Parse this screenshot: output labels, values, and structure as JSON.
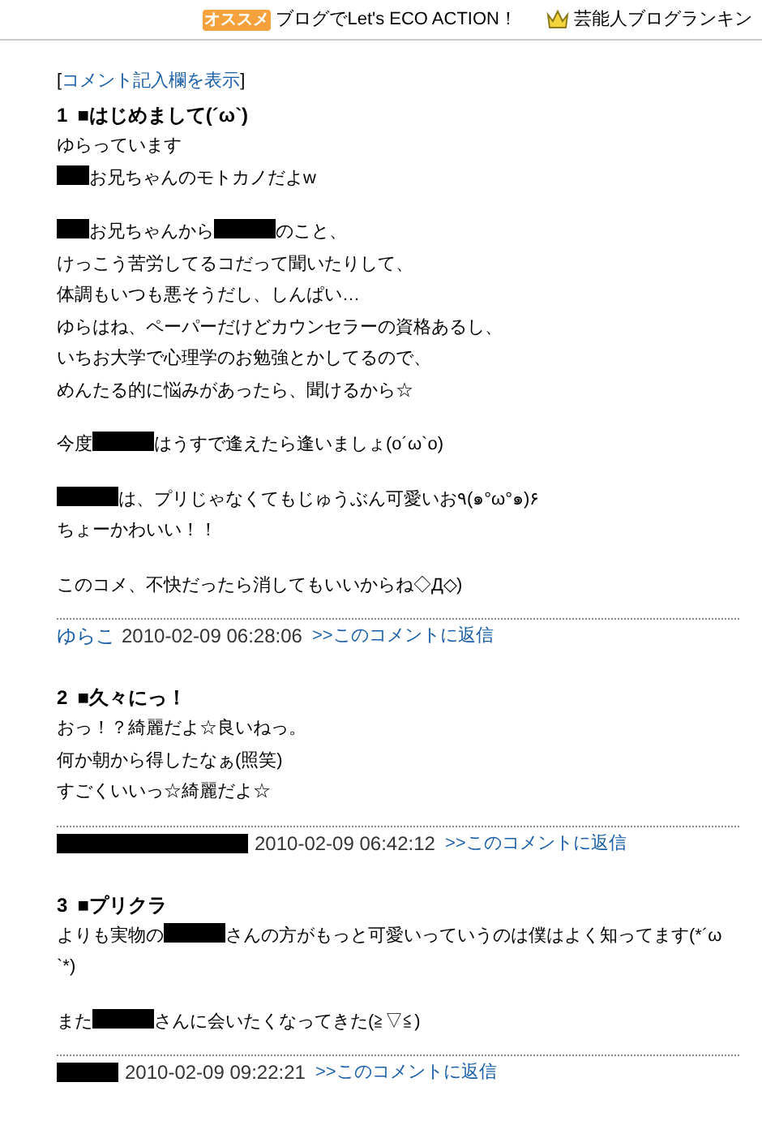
{
  "header": {
    "badge": "オススメ",
    "promo": "ブログでLet's ECO ACTION！",
    "ranking": "芸能人ブログランキン"
  },
  "show_form_link": {
    "open": "[",
    "label": "コメント記入欄を表示",
    "close": "]"
  },
  "comments": [
    {
      "number": "1",
      "title": "■はじめまして(´ω`)",
      "paragraphs": [
        [
          [
            {
              "kind": "text",
              "text": "ゆらっています"
            }
          ],
          [
            {
              "kind": "short_redaction"
            },
            {
              "kind": "text",
              "text": "お兄ちゃんのモトカノだよw"
            }
          ]
        ],
        [
          [
            {
              "kind": "short_redaction"
            },
            {
              "kind": "text",
              "text": "お兄ちゃんから"
            },
            {
              "kind": "redaction"
            },
            {
              "kind": "text",
              "text": "のこと、"
            }
          ],
          [
            {
              "kind": "text",
              "text": "けっこう苦労してるコだって聞いたりして、"
            }
          ],
          [
            {
              "kind": "text",
              "text": "体調もいつも悪そうだし、しんぱい…"
            }
          ],
          [
            {
              "kind": "text",
              "text": "ゆらはね、ペーパーだけどカウンセラーの資格あるし、"
            }
          ],
          [
            {
              "kind": "text",
              "text": "いちお大学で心理学のお勉強とかしてるので、"
            }
          ],
          [
            {
              "kind": "text",
              "text": "めんたる的に悩みがあったら、聞けるから☆"
            }
          ]
        ],
        [
          [
            {
              "kind": "text",
              "text": "今度"
            },
            {
              "kind": "redaction"
            },
            {
              "kind": "text",
              "text": "はうすで逢えたら逢いましょ(o´ω`o)"
            }
          ]
        ],
        [
          [
            {
              "kind": "redaction"
            },
            {
              "kind": "text",
              "text": "は、プリじゃなくてもじゅうぶん可愛いお٩(๑°ω°๑)۶"
            }
          ],
          [
            {
              "kind": "text",
              "text": "ちょーかわいい！！"
            }
          ]
        ],
        [
          [
            {
              "kind": "text",
              "text": "このコメ、不快だったら消してもいいからね◇Д◇)"
            }
          ]
        ]
      ],
      "author": {
        "kind": "text",
        "text": "ゆらこ"
      },
      "date": "2010-02-09 06:28:06",
      "reply": ">>このコメントに返信"
    },
    {
      "number": "2",
      "title": "■久々にっ！",
      "paragraphs": [
        [
          [
            {
              "kind": "text",
              "text": "おっ！？綺麗だよ☆良いねっ。"
            }
          ],
          [
            {
              "kind": "text",
              "text": "何か朝から得したなぁ(照笑)"
            }
          ],
          [
            {
              "kind": "text",
              "text": "すごくいいっ☆綺麗だよ☆"
            }
          ]
        ]
      ],
      "author": {
        "kind": "long_redaction"
      },
      "date": "2010-02-09 06:42:12",
      "reply": ">>このコメントに返信"
    },
    {
      "number": "3",
      "title": "■プリクラ",
      "paragraphs": [
        [
          [
            {
              "kind": "text",
              "text": "よりも実物の"
            },
            {
              "kind": "redaction"
            },
            {
              "kind": "text",
              "text": "さんの方がもっと可愛いっていうのは僕はよく知ってます(*´ω"
            }
          ],
          [
            {
              "kind": "text",
              "text": "`*)"
            }
          ]
        ],
        [
          [
            {
              "kind": "text",
              "text": "また"
            },
            {
              "kind": "redaction"
            },
            {
              "kind": "text",
              "text": "さんに会いたくなってきた(≧▽≦)"
            }
          ]
        ]
      ],
      "author": {
        "kind": "redaction"
      },
      "date": "2010-02-09 09:22:21",
      "reply": ">>このコメントに返信"
    }
  ]
}
